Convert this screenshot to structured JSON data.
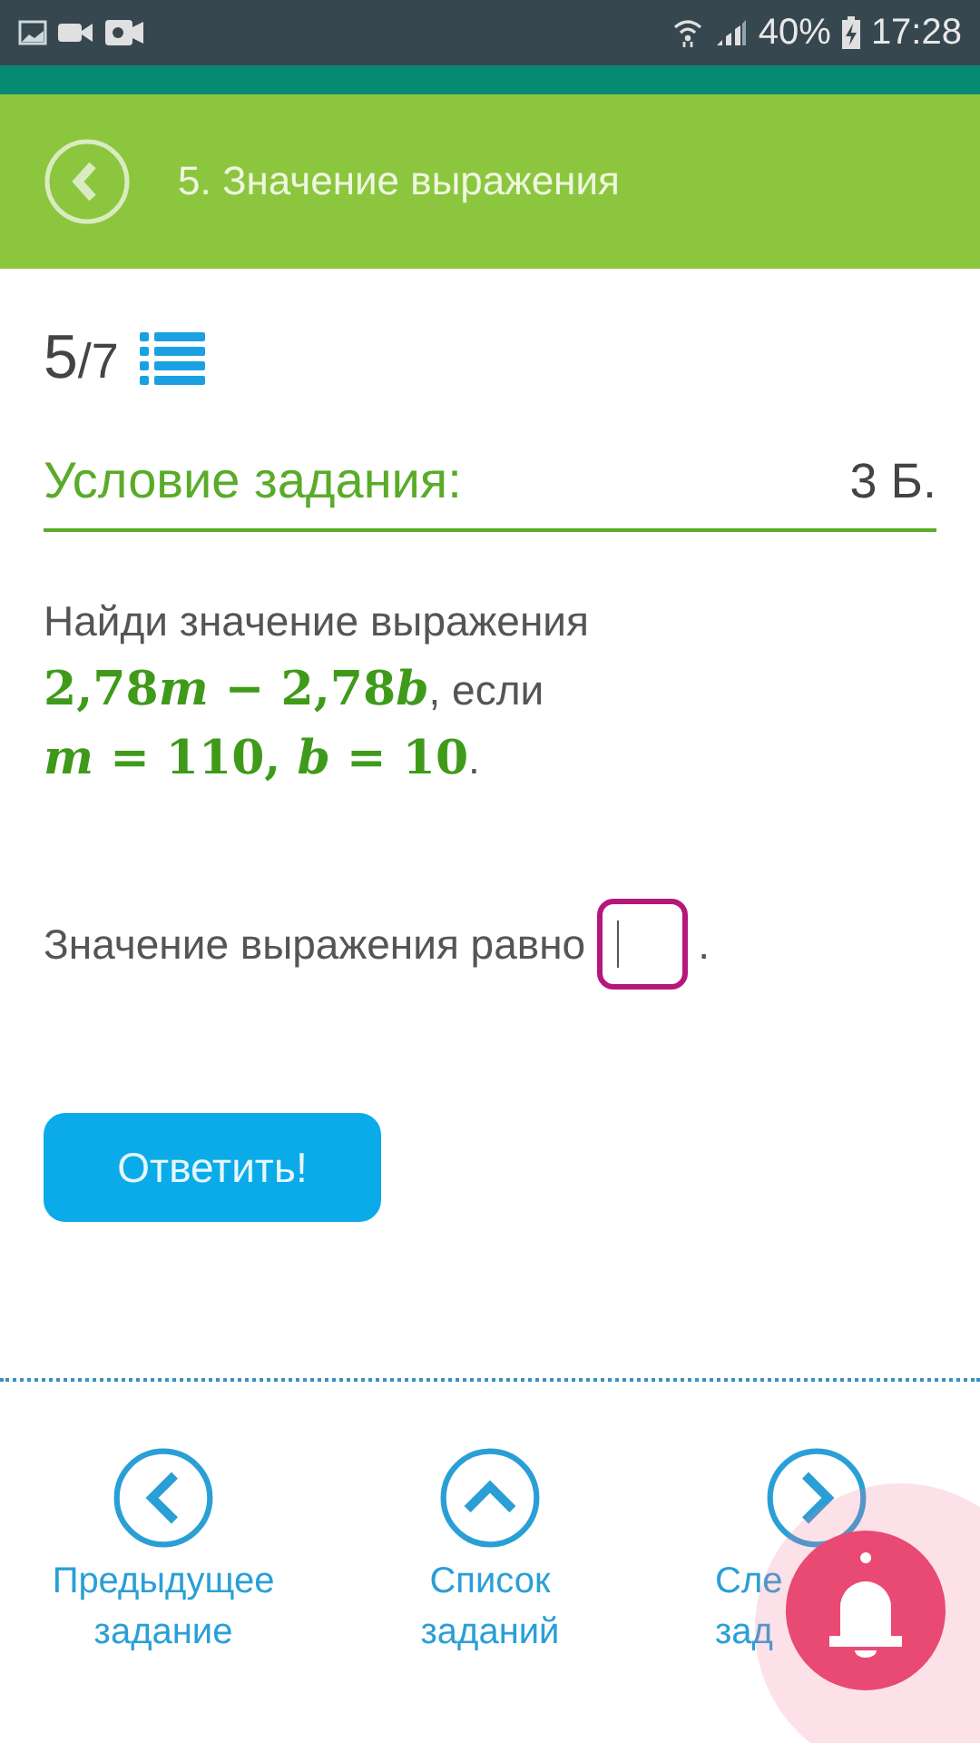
{
  "status_bar": {
    "battery": "40%",
    "time": "17:28"
  },
  "header": {
    "title": "5. Значение выражения"
  },
  "progress": {
    "current": "5",
    "total": "/7"
  },
  "section": {
    "title": "Условие задания:",
    "points": "3 Б."
  },
  "problem": [
    {
      "kind": "text",
      "text": "Найди значение выражения"
    },
    {
      "kind": "break"
    },
    {
      "kind": "math",
      "text": "2,78"
    },
    {
      "kind": "var",
      "text": "m"
    },
    {
      "kind": "math",
      "text": " − 2,78"
    },
    {
      "kind": "var",
      "text": "b"
    },
    {
      "kind": "text",
      "text": ", если"
    },
    {
      "kind": "break"
    },
    {
      "kind": "var",
      "text": "m"
    },
    {
      "kind": "math",
      "text": " = 110, "
    },
    {
      "kind": "var",
      "text": "b"
    },
    {
      "kind": "math",
      "text": " = 10"
    },
    {
      "kind": "text",
      "text": "."
    }
  ],
  "answer": {
    "label": "Значение выражения равно",
    "suffix": "."
  },
  "submit_button": "Ответить!",
  "nav": [
    {
      "kind": "prev",
      "lines": [
        "Предыдущее",
        "задание"
      ]
    },
    {
      "kind": "list",
      "lines": [
        "Список",
        "заданий"
      ]
    },
    {
      "kind": "next",
      "lines": [
        "Сле",
        "зад"
      ]
    }
  ]
}
